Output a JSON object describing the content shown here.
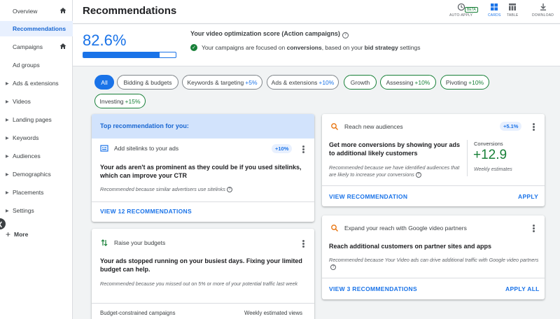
{
  "sidebar": {
    "items": [
      {
        "label": "Overview",
        "has_home": true,
        "has_caret": false,
        "active": false
      },
      {
        "label": "Recommendations",
        "has_home": false,
        "has_caret": false,
        "active": true
      },
      {
        "label": "Campaigns",
        "has_home": true,
        "has_caret": false,
        "active": false
      },
      {
        "label": "Ad groups",
        "has_home": false,
        "has_caret": false,
        "active": false
      },
      {
        "label": "Ads & extensions",
        "has_home": false,
        "has_caret": true,
        "active": false
      },
      {
        "label": "Videos",
        "has_home": false,
        "has_caret": true,
        "active": false
      },
      {
        "label": "Landing pages",
        "has_home": false,
        "has_caret": true,
        "active": false
      },
      {
        "label": "Keywords",
        "has_home": false,
        "has_caret": true,
        "active": false
      },
      {
        "label": "Audiences",
        "has_home": false,
        "has_caret": true,
        "active": false
      },
      {
        "label": "Demographics",
        "has_home": false,
        "has_caret": true,
        "active": false
      },
      {
        "label": "Placements",
        "has_home": false,
        "has_caret": true,
        "active": false
      },
      {
        "label": "Settings",
        "has_home": false,
        "has_caret": true,
        "active": false
      }
    ],
    "more_label": "More"
  },
  "header": {
    "title": "Recommendations",
    "tools": {
      "auto_apply": "AUTO-APPLY",
      "beta": "BETA",
      "cards": "CARDS",
      "table": "TABLE",
      "download": "DOWNLOAD"
    }
  },
  "score": {
    "value_text": "82.6%",
    "fraction": 0.826,
    "title": "Your video optimization score (Action campaigns)",
    "msg_prefix": "Your campaigns are focused on ",
    "msg_bold1": "conversions",
    "msg_mid": ", based on your ",
    "msg_bold2": "bid strategy",
    "msg_suffix": " settings"
  },
  "chips": [
    {
      "label": "All",
      "pct": "",
      "style": "selected"
    },
    {
      "label": "Bidding & budgets",
      "pct": "",
      "style": "normal"
    },
    {
      "label": "Keywords & targeting",
      "pct": "+5%",
      "style": "normal"
    },
    {
      "label": "Ads & extensions",
      "pct": "+10%",
      "style": "normal"
    },
    {
      "label": "Growth",
      "pct": "",
      "style": "green"
    },
    {
      "label": "Assessing",
      "pct": "+10%",
      "style": "green"
    },
    {
      "label": "Pivoting",
      "pct": "+10%",
      "style": "green"
    },
    {
      "label": "Investing",
      "pct": "+15%",
      "style": "green"
    }
  ],
  "card_sitelinks": {
    "banner": "Top recommendation for you:",
    "title": "Add sitelinks to your ads",
    "badge": "+10%",
    "body": "Your ads aren't as prominent as they could be if you used sitelinks, which can improve your CTR",
    "note": "Recommended because similar advertisers use sitelinks",
    "link": "VIEW 12 RECOMMENDATIONS"
  },
  "card_budgets": {
    "title": "Raise your budgets",
    "body": "Your ads stopped running on your busiest days. Fixing your limited budget can help.",
    "note": "Recommended because you missed out on 5% or more of your potential traffic last week",
    "footer_left": "Budget-constrained campaigns",
    "footer_right": "Weekly estimated views"
  },
  "card_audiences": {
    "title": "Reach new audiences",
    "badge": "+5.1%",
    "body": "Get more conversions by showing your ads to additional likely customers",
    "note": "Recommended because we have identified audiences that are likely to increase your conversions",
    "metric_label": "Conversions",
    "metric_value": "+12.9",
    "metric_sub": "Weekly estimates",
    "link": "VIEW RECOMMENDATION",
    "apply": "APPLY"
  },
  "card_partners": {
    "title": "Expand your reach with Google video partners",
    "body": "Reach additional customers on partner sites and apps",
    "note": "Recommended because Your Video ads can drive additional traffic with Google video partners",
    "link": "VIEW 3 RECOMMENDATIONS",
    "apply": "APPLY ALL"
  },
  "colors": {
    "accent": "#1a73e8",
    "positive": "#188038",
    "banner": "#d2e3fc"
  }
}
